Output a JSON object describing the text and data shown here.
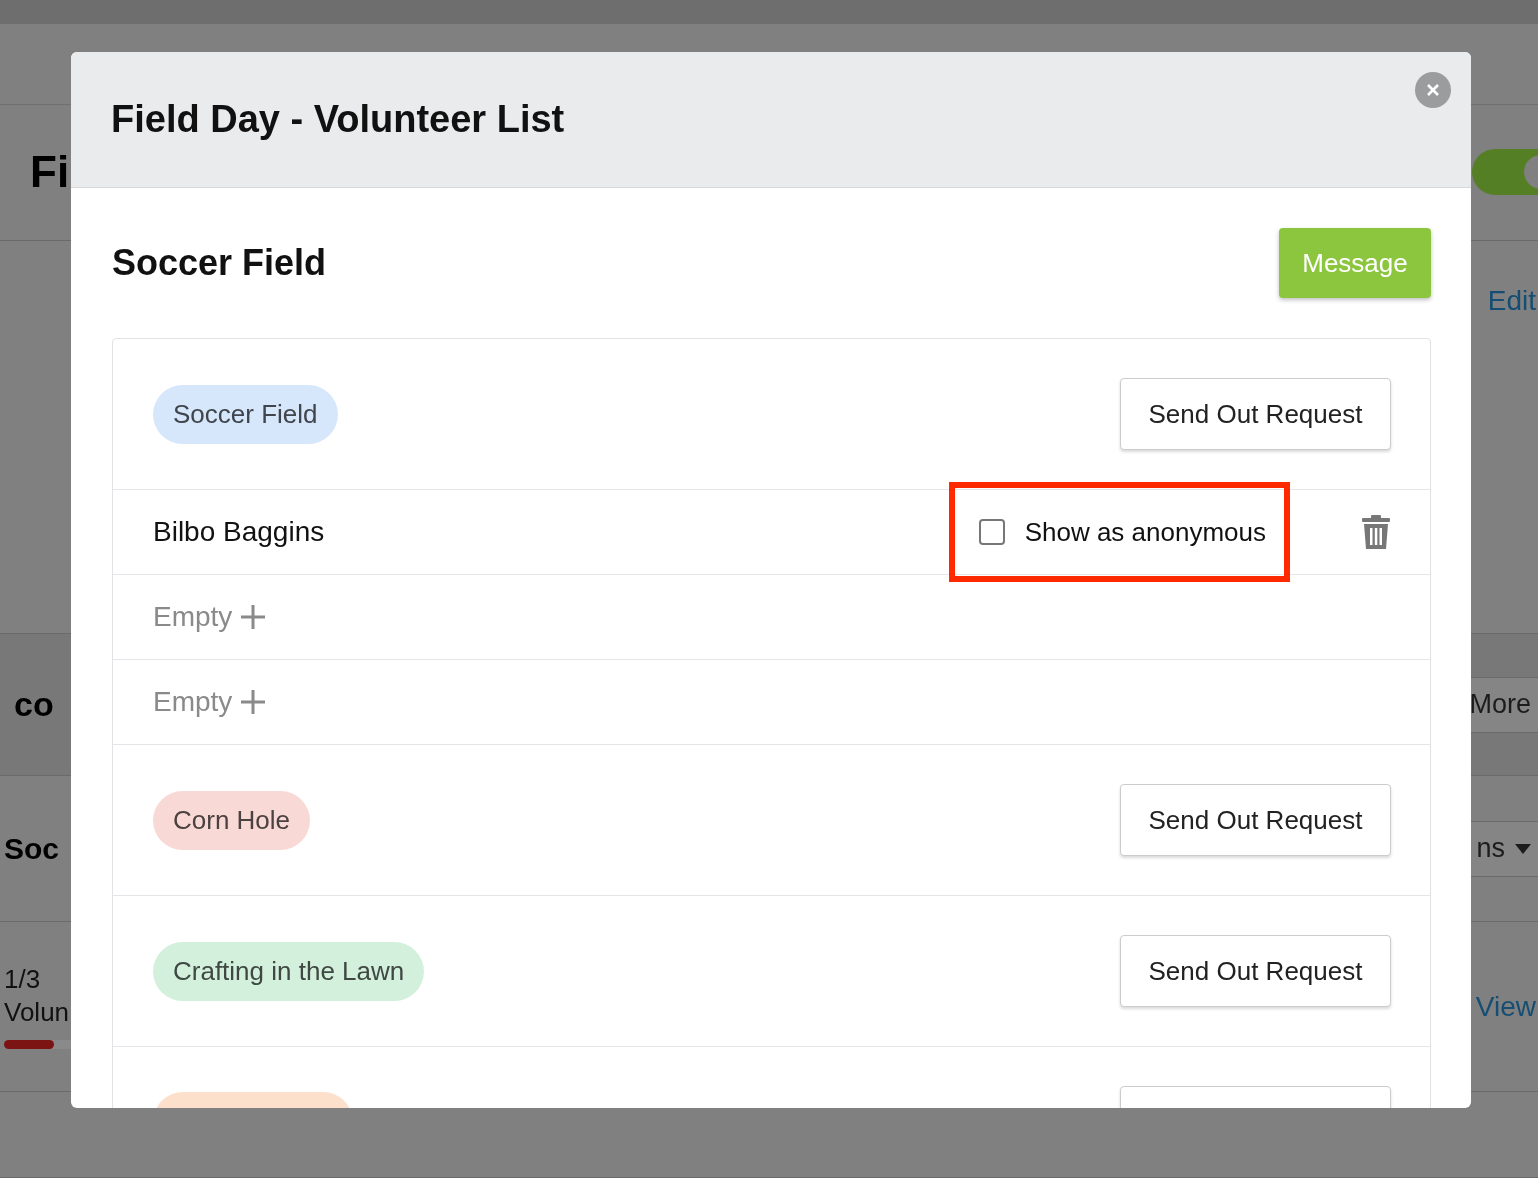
{
  "page": {
    "title": "Fi",
    "edit_link": "Edit",
    "section_title": "co",
    "more_button": "More",
    "item_title": "Soc",
    "actions_button": "ns",
    "progress": {
      "count": "1/3",
      "label": "Volun",
      "level": 0.33
    },
    "view_link": "View",
    "toggle": {
      "on": true
    }
  },
  "modal": {
    "title": "Field Day - Volunteer List",
    "subtitle": "Soccer Field",
    "message_button": "Message",
    "groups": [
      {
        "label": "Soccer Field",
        "color": "#d6e6fb",
        "button": "Send Out Request",
        "slots": [
          {
            "kind": "volunteer",
            "name": "Bilbo Baggins",
            "anonymous": {
              "label": "Show as anonymous",
              "checked": false
            },
            "highlighted": true
          },
          {
            "kind": "empty",
            "label": "Empty"
          },
          {
            "kind": "empty",
            "label": "Empty"
          }
        ]
      },
      {
        "label": "Corn Hole",
        "color": "#f9d9d6",
        "button": "Send Out Request"
      },
      {
        "label": "Crafting in the Lawn",
        "color": "#d3f0dc",
        "button": "Send Out Request"
      },
      {
        "color": "#fde0cc"
      }
    ]
  }
}
